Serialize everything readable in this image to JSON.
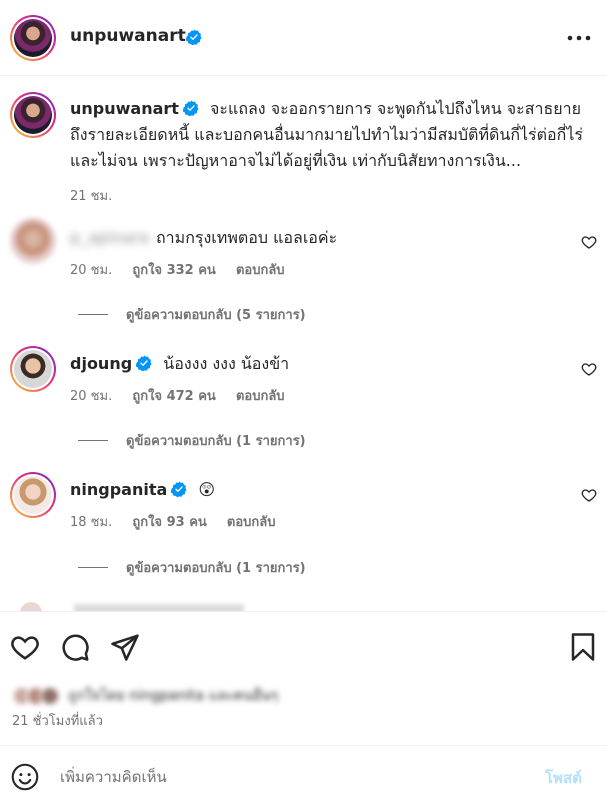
{
  "header": {
    "username": "unpuwanart"
  },
  "caption": {
    "username": "unpuwanart",
    "text": "จะแถลง จะออกรายการ จะพูดกันไปถึงไหน จะสาธยายถึงรายละเอียดหนี้ และบอกคนอื่นมากมายไปทำไมว่ามีสมบัติที่ดินกี่ไร่ต่อกี่ไร่ และไม่จน เพราะปัญหาอาจไม่ได้อยู่ที่เงิน เท่ากับนิสัยทางการเงิน...",
    "time": "21 ชม."
  },
  "comments": [
    {
      "username": "p_apinara",
      "text": "ถามกรุงเทพตอบ แอลเอค่ะ",
      "time": "20 ชม.",
      "likes": "ถูกใจ 332 คน",
      "reply_label": "ตอบกลับ",
      "view_replies": "ดูข้อความตอบกลับ (5 รายการ)"
    },
    {
      "username": "djoung",
      "text": "น้องงง งงง น้องข้า",
      "time": "20 ชม.",
      "likes": "ถูกใจ 472 คน",
      "reply_label": "ตอบกลับ",
      "view_replies": "ดูข้อความตอบกลับ (1 รายการ)"
    },
    {
      "username": "ningpanita",
      "text": "😲",
      "time": "18 ชม.",
      "likes": "ถูกใจ 93 คน",
      "reply_label": "ตอบกลับ",
      "view_replies": "ดูข้อความตอบกลับ (1 รายการ)"
    }
  ],
  "liked_by": {
    "text": "ถูกใจโดย ningpanita และคนอื่นๆ"
  },
  "post_time": "21 ชั่วโมงที่แล้ว",
  "composer": {
    "placeholder": "เพิ่มความคิดเห็น",
    "post_label": "โพสต์"
  },
  "icons": {
    "more": "more-horizontal-icon",
    "verified": "verified-badge-icon",
    "like": "heart-icon",
    "comment": "comment-icon",
    "share": "share-icon",
    "save": "bookmark-icon",
    "emoji": "emoji-icon"
  },
  "colors": {
    "verified": "#0095f6",
    "muted": "#737373",
    "post_disabled": "#b2dffc"
  }
}
